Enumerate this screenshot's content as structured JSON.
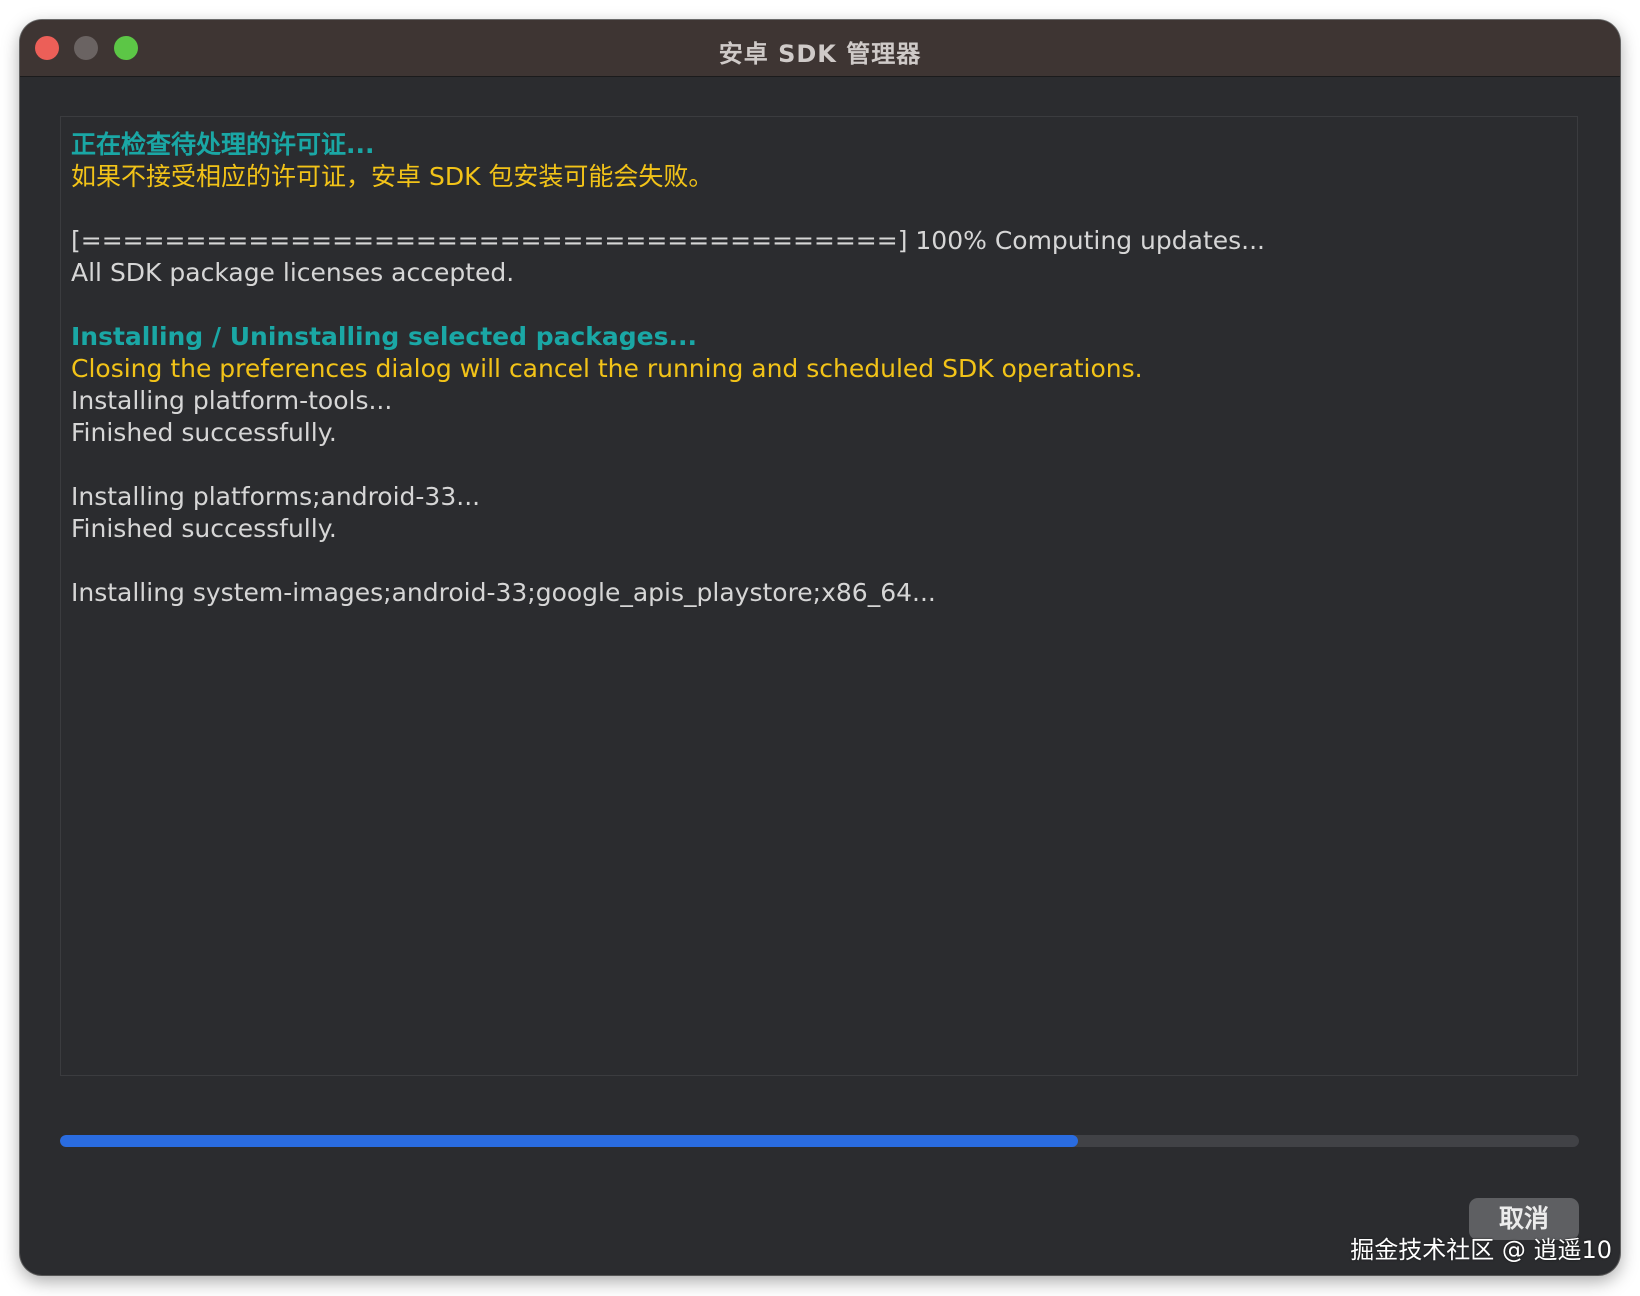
{
  "window": {
    "title": "安卓 SDK 管理器"
  },
  "log": {
    "lines": [
      {
        "text": "正在检查待处理的许可证...",
        "style": "teal"
      },
      {
        "text": "如果不接受相应的许可证，安卓 SDK 包安装可能会失败。",
        "style": "yellow"
      },
      {
        "text": "",
        "style": "gap"
      },
      {
        "text": "[=======================================] 100% Computing updates...",
        "style": "normal"
      },
      {
        "text": "All SDK package licenses accepted.",
        "style": "normal"
      },
      {
        "text": "",
        "style": "gap"
      },
      {
        "text": "Installing / Uninstalling selected packages...",
        "style": "teal"
      },
      {
        "text": "Closing the preferences dialog will cancel the running and scheduled SDK operations.",
        "style": "yellow"
      },
      {
        "text": "Installing platform-tools...",
        "style": "normal"
      },
      {
        "text": "Finished successfully.",
        "style": "normal"
      },
      {
        "text": "",
        "style": "gap"
      },
      {
        "text": "Installing platforms;android-33...",
        "style": "normal"
      },
      {
        "text": "Finished successfully.",
        "style": "normal"
      },
      {
        "text": "",
        "style": "gap"
      },
      {
        "text": "Installing system-images;android-33;google_apis_playstore;x86_64...",
        "style": "normal"
      }
    ]
  },
  "progress": {
    "fraction": 0.67
  },
  "buttons": {
    "cancel_label": "取消"
  },
  "watermark": {
    "text": "掘金技术社区 @ 逍遥10"
  },
  "colors": {
    "accent_teal": "#1aa7a5",
    "warning_yellow": "#f2c318",
    "progress_blue": "#2a6ce0"
  }
}
